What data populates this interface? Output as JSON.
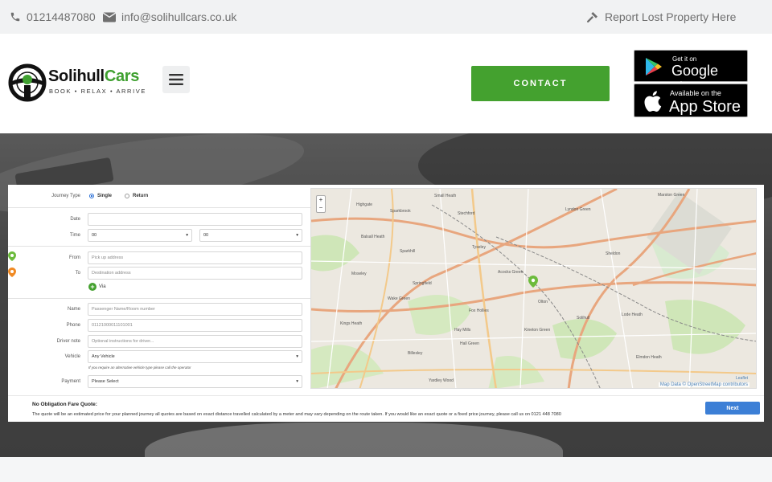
{
  "topbar": {
    "phone": "01214487080",
    "email": "info@solihullcars.co.uk",
    "report": "Report Lost Property Here"
  },
  "header": {
    "logo_name_part1": "Solihull",
    "logo_name_part2": "Cars",
    "logo_tagline": "BOOK • RELAX • ARRIVE",
    "contact_label": "CONTACT",
    "google_play_small": "Get it on",
    "google_play_big": "Google play",
    "app_store_small": "Available on the",
    "app_store_big": "App Store",
    "colors": {
      "brand_green": "#44a12f"
    }
  },
  "booking": {
    "journey_type_label": "Journey Type",
    "journey_options": [
      "Single",
      "Return"
    ],
    "journey_selected": "Single",
    "date_label": "Date",
    "date_value": "",
    "time_label": "Time",
    "time_hour": "00",
    "time_minute": "00",
    "from_label": "From",
    "from_placeholder": "Pick up address",
    "to_label": "To",
    "to_placeholder": "Destination address",
    "via_label": "Via",
    "name_label": "Name",
    "name_placeholder": "Passenger Name/Room number",
    "phone_label": "Phone",
    "phone_placeholder": "01121000011101001",
    "note_label": "Driver note",
    "note_placeholder": "Optional instructions for driver...",
    "vehicle_label": "Vehicle",
    "vehicle_value": "Any Vehicle",
    "vehicle_hint": "If you require an alternative vehicle type please call the operator",
    "payment_label": "Payment",
    "payment_value": "Please Select"
  },
  "map": {
    "zoom_in": "+",
    "zoom_out": "−",
    "attribution": "Map Data © OpenStreetMap contributors",
    "leaflet": "Leaflet",
    "place_labels": [
      "Small Heath",
      "Highgate",
      "Sparkbrook",
      "Balsall Heath",
      "Sparkhill",
      "Tyseley",
      "Moseley",
      "Springfield",
      "Acocks Green",
      "Hall Green",
      "Kings Heath",
      "Billesley",
      "Yardley Wood",
      "Olton",
      "Sheldon",
      "Marston Green",
      "Lyndon Green",
      "Elmdon Heath",
      "Solihull",
      "Kineton Green",
      "Lode Heath",
      "Fox Hollies",
      "Hay Mills",
      "Stechford",
      "Wake Green"
    ]
  },
  "quote": {
    "title": "No Obligation Fare Quote:",
    "description": "The quote will be an estimated price for your planned journey all quotes are based on exact distance travelled calculated by a meter and may vary depending on the route taken. If you would like an exact quote or a fixed price journey, please call us on 0121 448 7080",
    "next_label": "Next"
  }
}
